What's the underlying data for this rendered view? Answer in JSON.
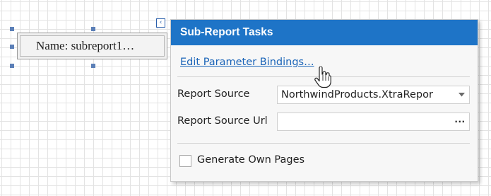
{
  "subreport": {
    "label": "Name: subreport1…"
  },
  "smart_tag": {
    "glyph": "‹",
    "icon": "smart-tag-icon"
  },
  "panel": {
    "title": "Sub-Report Tasks",
    "edit_link": "Edit Parameter Bindings…",
    "report_source": {
      "label": "Report Source",
      "value": "NorthwindProducts.XtraRepor"
    },
    "report_source_url": {
      "label": "Report Source Url",
      "value": "",
      "button_label": "···"
    },
    "generate_own_pages": {
      "label": "Generate Own Pages",
      "checked": false
    }
  },
  "colors": {
    "header_bg": "#1e74c7",
    "link": "#1a64b8",
    "handle": "#5b7fb7"
  }
}
